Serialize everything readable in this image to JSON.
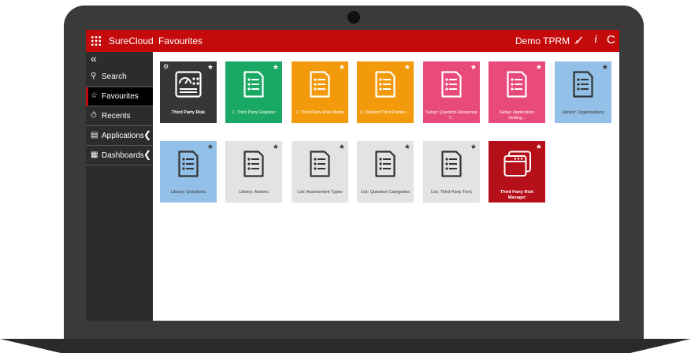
{
  "app": {
    "brand": "SureCloud",
    "page_title": "Favourites",
    "env": "Demo TPRM",
    "env_chevron": "⌄",
    "check": "✓",
    "info": "i",
    "refresh": "C"
  },
  "sidebar": {
    "collapse": "«",
    "items": [
      {
        "label": "Search",
        "icon": "⚲"
      },
      {
        "label": "Favourites",
        "icon": "☆"
      },
      {
        "label": "Recents",
        "icon": "⏱"
      },
      {
        "label": "Applications",
        "icon": "▤",
        "arrow": "❮"
      },
      {
        "label": "Dashboards",
        "icon": "▦",
        "arrow": "❮"
      }
    ]
  },
  "tiles": [
    {
      "label": "Third Party Risk",
      "bg": "#363636",
      "fg": "#ffffff",
      "bold": true,
      "star": "★",
      "badge": "⚙"
    },
    {
      "label": "1. Third Party Register",
      "bg": "#1aa865",
      "fg": "#ffffff",
      "star": "★"
    },
    {
      "label": "2. Third Party Risk Matrix",
      "bg": "#f39a0c",
      "fg": "#ffffff",
      "star": "★"
    },
    {
      "label": "3. Riskiest Third Parties ...",
      "bg": "#f39a0c",
      "fg": "#ffffff",
      "star": "★"
    },
    {
      "label": "Setup: Question Response T...",
      "bg": "#e84a7c",
      "fg": "#ffffff",
      "star": "★"
    },
    {
      "label": "Setup: Application Setting...",
      "bg": "#e84a7c",
      "fg": "#ffffff",
      "star": "★"
    },
    {
      "label": "Library: Organisations",
      "bg": "#92c0e8",
      "fg": "#333333",
      "star": "★"
    },
    {
      "label": "Library: Questions",
      "bg": "#92c0e8",
      "fg": "#333333",
      "star": "★"
    },
    {
      "label": "Library: Actions",
      "bg": "#e3e3e3",
      "fg": "#333333",
      "star": "★"
    },
    {
      "label": "List: Assessment Types",
      "bg": "#e3e3e3",
      "fg": "#333333",
      "star": "★"
    },
    {
      "label": "List: Question Categories",
      "bg": "#e3e3e3",
      "fg": "#333333",
      "star": "★"
    },
    {
      "label": "List: Third Party Tiers",
      "bg": "#e3e3e3",
      "fg": "#333333",
      "star": "★"
    },
    {
      "label": "Third Party Risk Manager",
      "bg": "#b5101a",
      "fg": "#ffffff",
      "bold": true,
      "star": "★"
    }
  ]
}
